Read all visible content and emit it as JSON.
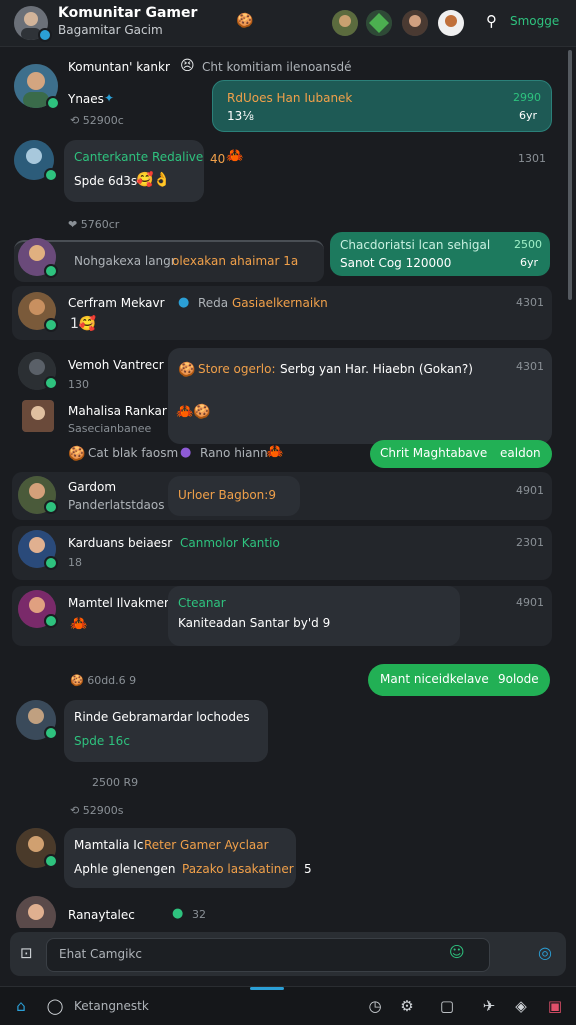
{
  "header": {
    "title": "Komunitar Gamer",
    "subtitle": "Bagamitar Gacim",
    "search_label": "Smogge"
  },
  "messages": [
    {
      "name": "Komuntan' kankr",
      "inline": "Cht komitiam ilenoansdé"
    },
    {
      "name": "Ynaes",
      "likes": "52900c",
      "bubble_title": "RdUoes Han Iubanek",
      "bubble_text": "13⅛",
      "bubble_meta": "2990",
      "bubble_meta2": "6yr"
    },
    {
      "name": "",
      "bubble_title": "Canterkante Redalive",
      "bubble_text": "Spde 6d3s",
      "extra": "40",
      "time": "1301",
      "likes": "5760cr"
    },
    {
      "name": "Nohgakexa langr",
      "inline_orange": "olexakan ahaimar 1a",
      "bubble_title": "Chacdoriatsi lcan sehigal",
      "bubble_text": "Sanot Cog 120000",
      "bubble_meta": "2500",
      "bubble_meta2": "6yr"
    },
    {
      "name": "Cerfram Mekavr",
      "inline": "Reda",
      "inline_orange": "Gasiaelkernaikn",
      "time": "4301"
    },
    {
      "name": "Vemoh Vantrecr",
      "count": "130",
      "bubble_title": "Store ogerlo:",
      "bubble_text": "Serbg yan Har. Hiaebn (Gokan?)",
      "time": "4301"
    },
    {
      "name": "Mahalisa Rankar",
      "sub": "Sasecianbanee",
      "footer_a": "Cat blak faosm",
      "footer_b": "Rano hiann",
      "pill": "Chrit Maghtabave",
      "pill_b": "ealdon"
    },
    {
      "name": "Gardom",
      "sub": "Panderlatstdaos",
      "bubble_text": "Urloer Bagbon:9",
      "time": "4901"
    },
    {
      "name": "Karduans beiaesr",
      "count": "18",
      "bubble_text": "Canmolor Kantio",
      "time": "2301"
    },
    {
      "name": "Mamtel Ilvakmer",
      "bubble_title": "Cteanar",
      "bubble_text": "Kaniteadan Santar by'd 9",
      "time": "4901"
    },
    {
      "name": "",
      "likes": "60dd.6 9",
      "pill": "Mant niceidkelave",
      "pill_b": "9olode"
    },
    {
      "name": "Rinde Gebramardar lochodes",
      "bubble_text": "Spde 16c"
    },
    {
      "time_center": "2500 R9",
      "likes": "52900s"
    },
    {
      "name": "Mamtalia Ic",
      "name_green": "Reter Gamer Ayclaar",
      "bubble_text": "Aphle glenengen",
      "bubble_text_b": "Pazako lasakatiner",
      "count": "5"
    },
    {
      "name": "Ranaytalec",
      "count": "32"
    }
  ],
  "composer": {
    "placeholder": "Ehat Camgikc"
  },
  "nav": {
    "chat_label": "Ketangnestk"
  },
  "colors": {
    "accent_green": "#2ec27e",
    "pill_green": "#22b055",
    "orange": "#f0a04a",
    "bg": "#1a1c20"
  }
}
